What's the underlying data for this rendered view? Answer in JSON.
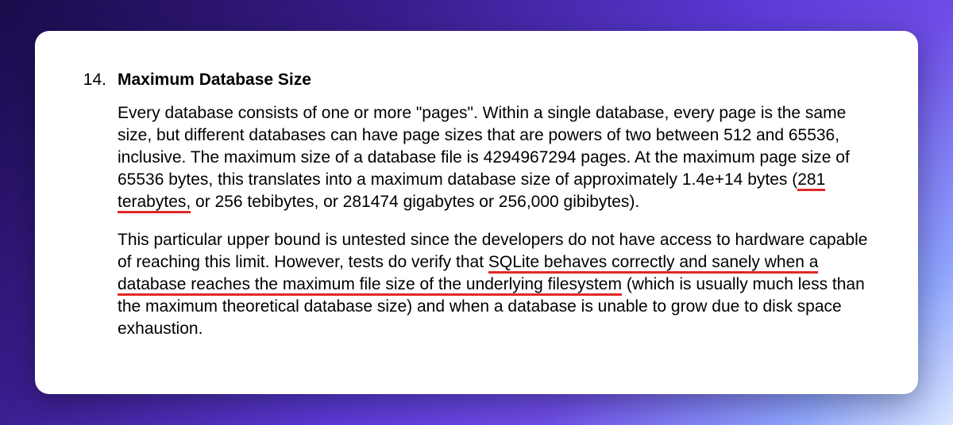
{
  "item_number": "14.",
  "title": "Maximum Database Size",
  "p1_a": "Every database consists of one or more \"pages\". Within a single database, every page is the same size, but different databases can have page sizes that are powers of two between 512 and 65536, inclusive. The maximum size of a database file is 4294967294 pages. At the maximum page size of 65536 bytes, this translates into a maximum database size of approximately 1.4e+14 bytes (",
  "p1_u": "281 terabytes,",
  "p1_b": " or 256 tebibytes, or 281474 gigabytes or 256,000 gibibytes).",
  "p2_a": "This particular upper bound is untested since the developers do not have access to hardware capable of reaching this limit. However, tests do verify that ",
  "p2_u": "SQLite behaves correctly and sanely when a database reaches the maximum file size of the underlying filesystem",
  "p2_b": " (which is usually much less than the maximum theoretical database size) and when a database is unable to grow due to disk space exhaustion."
}
